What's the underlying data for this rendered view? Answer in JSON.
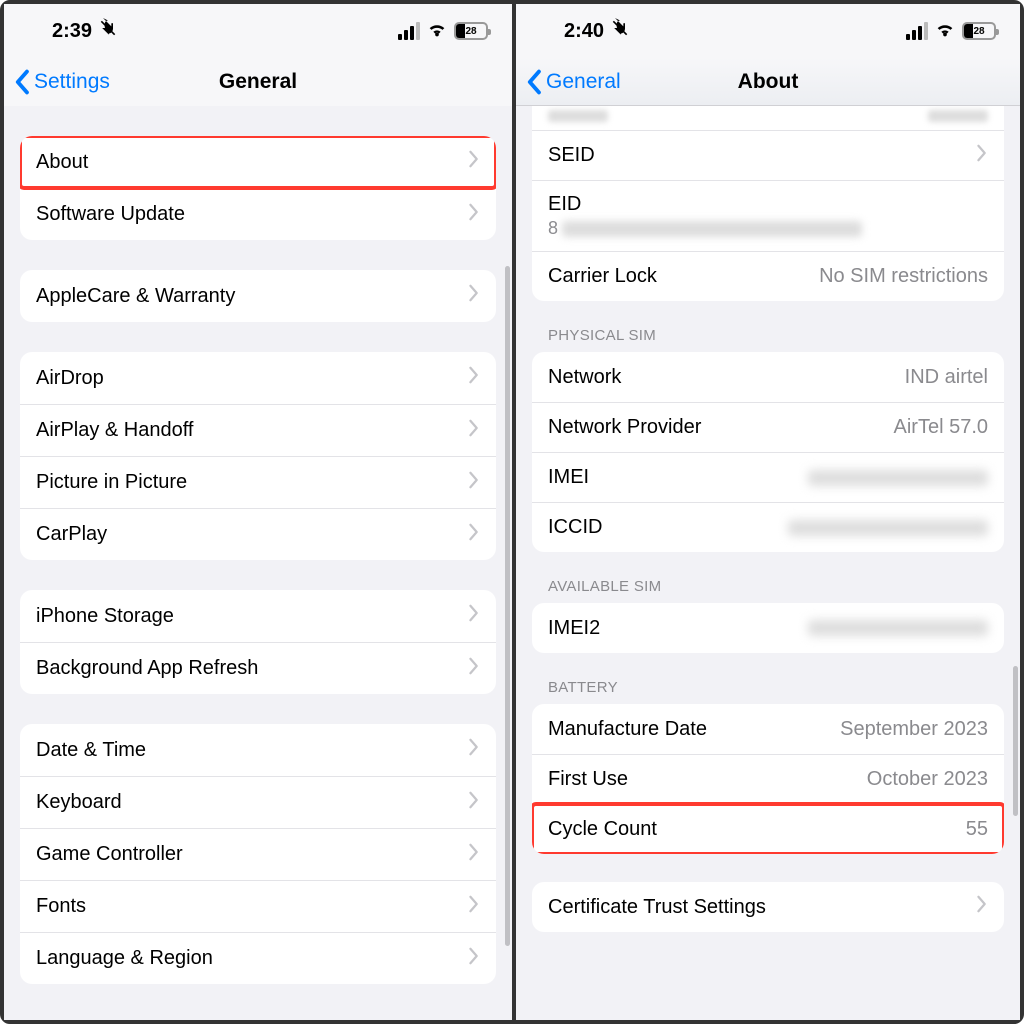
{
  "left": {
    "status": {
      "time": "2:39",
      "battery_pct": "28"
    },
    "nav": {
      "back": "Settings",
      "title": "General"
    },
    "groups": [
      {
        "rows": [
          {
            "label": "About",
            "chevron": true,
            "highlight": true
          },
          {
            "label": "Software Update",
            "chevron": true
          }
        ]
      },
      {
        "rows": [
          {
            "label": "AppleCare & Warranty",
            "chevron": true
          }
        ]
      },
      {
        "rows": [
          {
            "label": "AirDrop",
            "chevron": true
          },
          {
            "label": "AirPlay & Handoff",
            "chevron": true
          },
          {
            "label": "Picture in Picture",
            "chevron": true
          },
          {
            "label": "CarPlay",
            "chevron": true
          }
        ]
      },
      {
        "rows": [
          {
            "label": "iPhone Storage",
            "chevron": true
          },
          {
            "label": "Background App Refresh",
            "chevron": true
          }
        ]
      },
      {
        "rows": [
          {
            "label": "Date & Time",
            "chevron": true
          },
          {
            "label": "Keyboard",
            "chevron": true
          },
          {
            "label": "Game Controller",
            "chevron": true
          },
          {
            "label": "Fonts",
            "chevron": true
          },
          {
            "label": "Language & Region",
            "chevron": true
          }
        ]
      }
    ]
  },
  "right": {
    "status": {
      "time": "2:40",
      "battery_pct": "28"
    },
    "nav": {
      "back": "General",
      "title": "About"
    },
    "top_group": {
      "rows": [
        {
          "label": "SEID",
          "chevron": true
        },
        {
          "label": "EID",
          "eid_prefix": "8",
          "blur": true
        },
        {
          "label": "Carrier Lock",
          "value": "No SIM restrictions"
        }
      ]
    },
    "physical_sim": {
      "header": "PHYSICAL SIM",
      "rows": [
        {
          "label": "Network",
          "value": "IND airtel"
        },
        {
          "label": "Network Provider",
          "value": "AirTel 57.0"
        },
        {
          "label": "IMEI",
          "blur": true
        },
        {
          "label": "ICCID",
          "blur": true
        }
      ]
    },
    "available_sim": {
      "header": "AVAILABLE SIM",
      "rows": [
        {
          "label": "IMEI2",
          "blur": true
        }
      ]
    },
    "battery": {
      "header": "BATTERY",
      "rows": [
        {
          "label": "Manufacture Date",
          "value": "September 2023"
        },
        {
          "label": "First Use",
          "value": "October 2023"
        },
        {
          "label": "Cycle Count",
          "value": "55",
          "highlight": true
        }
      ]
    },
    "cert": {
      "label": "Certificate Trust Settings"
    }
  }
}
